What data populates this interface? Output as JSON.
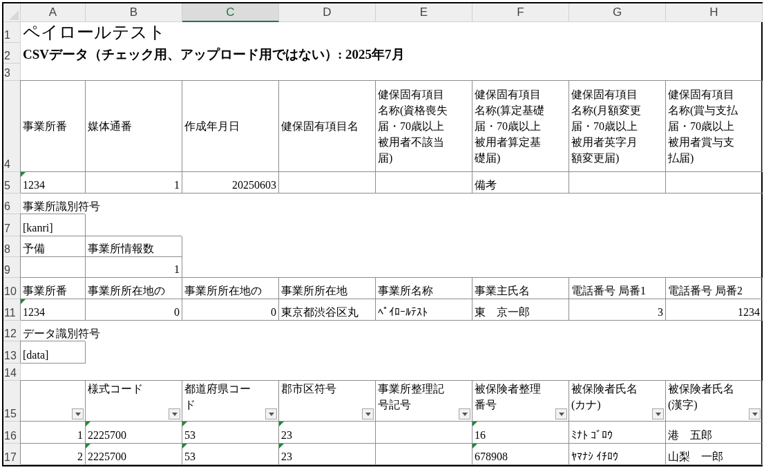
{
  "columns": [
    {
      "label": "A",
      "selected": false
    },
    {
      "label": "B",
      "selected": false
    },
    {
      "label": "C",
      "selected": true
    },
    {
      "label": "D",
      "selected": false
    },
    {
      "label": "E",
      "selected": false
    },
    {
      "label": "F",
      "selected": false
    },
    {
      "label": "G",
      "selected": false
    },
    {
      "label": "H",
      "selected": false
    }
  ],
  "rows": [
    {
      "label": "1",
      "cells": [
        {
          "text": "ペイロールテスト",
          "kind": "title",
          "bordered": false
        }
      ]
    },
    {
      "label": "2",
      "cells": [
        {
          "text": "CSVデータ（チェック用、アップロード用ではない）: 2025年7月",
          "kind": "subtitle",
          "bordered": false
        }
      ]
    },
    {
      "label": "3"
    },
    {
      "label": "4",
      "cells": [
        {
          "text": "事業所番",
          "kind": "text",
          "bordered": true
        },
        {
          "text": "媒体通番",
          "kind": "text",
          "bordered": true
        },
        {
          "text": "作成年月日",
          "kind": "text",
          "bordered": true
        },
        {
          "text": "健保固有項目名",
          "kind": "text",
          "bordered": true
        },
        {
          "text": "健保固有項目名称(資格喪失届・70歳以上被用者不該当届)",
          "kind": "text",
          "bordered": true
        },
        {
          "text": "健保固有項目名称(算定基礎届・70歳以上被用者算定基礎届)",
          "kind": "text",
          "bordered": true
        },
        {
          "text": "健保固有項目名称(月額変更届・70歳以上被用者英字月額変更届)",
          "kind": "text",
          "bordered": true
        },
        {
          "text": "健保固有項目名称(賞与支払届・70歳以上被用者賞与支払届)",
          "kind": "text",
          "bordered": true
        }
      ]
    },
    {
      "label": "5",
      "cells": [
        {
          "text": "1234",
          "kind": "number_text",
          "bordered": true
        },
        {
          "text": "1",
          "kind": "number",
          "bordered": true
        },
        {
          "text": "20250603",
          "kind": "number",
          "bordered": true
        },
        {
          "bordered": true
        },
        {
          "bordered": true
        },
        {
          "text": "備考",
          "kind": "text",
          "bordered": true
        },
        {
          "bordered": true
        },
        {
          "bordered": true
        }
      ]
    },
    {
      "label": "6",
      "cells": [
        {
          "text": "事業所識別符号",
          "kind": "text",
          "bordered": false
        }
      ]
    },
    {
      "label": "7",
      "cells": [
        {
          "text": "[kanri]",
          "kind": "text",
          "bordered": true
        }
      ]
    },
    {
      "label": "8",
      "cells": [
        {
          "text": "予備",
          "kind": "text",
          "bordered": true
        },
        {
          "text": "事業所情報数",
          "kind": "text",
          "bordered": true
        }
      ]
    },
    {
      "label": "9",
      "cells": [
        {
          "bordered": true
        },
        {
          "text": "1",
          "kind": "number",
          "bordered": true
        }
      ]
    },
    {
      "label": "10",
      "cells": [
        {
          "text": "事業所番",
          "kind": "text",
          "bordered": true
        },
        {
          "text": "事業所所在地の",
          "kind": "text",
          "bordered": true
        },
        {
          "text": "事業所所在地の",
          "kind": "text",
          "bordered": true
        },
        {
          "text": "事業所所在地",
          "kind": "text",
          "bordered": true
        },
        {
          "text": "事業所名称",
          "kind": "text",
          "bordered": true
        },
        {
          "text": "事業主氏名",
          "kind": "text",
          "bordered": true
        },
        {
          "text": "電話番号 局番1",
          "kind": "text",
          "bordered": true
        },
        {
          "text": "電話番号 局番2",
          "kind": "text",
          "bordered": true
        }
      ]
    },
    {
      "label": "11",
      "cells": [
        {
          "text": "1234",
          "kind": "number_text",
          "bordered": true
        },
        {
          "text": "0",
          "kind": "number",
          "bordered": true
        },
        {
          "text": "0",
          "kind": "number",
          "bordered": true
        },
        {
          "text": "東京都渋谷区丸",
          "kind": "text",
          "bordered": true
        },
        {
          "text": "ﾍﾟｲﾛｰﾙﾃｽﾄ",
          "kind": "text",
          "bordered": true
        },
        {
          "text": "東　京一郎",
          "kind": "text",
          "bordered": true
        },
        {
          "text": "3",
          "kind": "number",
          "bordered": true
        },
        {
          "text": "1234",
          "kind": "number",
          "bordered": true
        }
      ]
    },
    {
      "label": "12",
      "cells": [
        {
          "text": "データ識別符号",
          "kind": "text",
          "bordered": false
        }
      ]
    },
    {
      "label": "13",
      "cells": [
        {
          "text": "[data]",
          "kind": "text",
          "bordered": true
        }
      ]
    },
    {
      "label": "14"
    },
    {
      "label": "15",
      "cells": [
        {
          "bordered": true,
          "filter": true
        },
        {
          "text": "様式コード",
          "kind": "text",
          "bordered": true,
          "filter": true
        },
        {
          "text": "都道府県コード",
          "kind": "text",
          "bordered": true,
          "filter": true
        },
        {
          "text": "郡市区符号",
          "kind": "text",
          "bordered": true,
          "filter": true
        },
        {
          "text": "事業所整理記号記号",
          "kind": "text",
          "bordered": true,
          "filter": true
        },
        {
          "text": "被保険者整理番号",
          "kind": "text",
          "bordered": true,
          "filter": true
        },
        {
          "text": "被保険者氏名\n(カナ)",
          "kind": "text",
          "bordered": true,
          "filter": true
        },
        {
          "text": "被保険者氏名\n(漢字)",
          "kind": "text",
          "bordered": true,
          "filter": true
        }
      ]
    },
    {
      "label": "16",
      "cells": [
        {
          "text": "1",
          "kind": "number",
          "bordered": true
        },
        {
          "text": "2225700",
          "kind": "number_text",
          "bordered": true
        },
        {
          "text": "53",
          "kind": "number_text",
          "bordered": true
        },
        {
          "text": "23",
          "kind": "number_text",
          "bordered": true
        },
        {
          "bordered": true
        },
        {
          "text": "16",
          "kind": "number_text",
          "bordered": true
        },
        {
          "text": "ﾐﾅﾄ ｺﾞﾛｳ",
          "kind": "text",
          "bordered": true
        },
        {
          "text": "港　五郎",
          "kind": "text",
          "bordered": true
        }
      ]
    },
    {
      "label": "17",
      "cells": [
        {
          "text": "2",
          "kind": "number",
          "bordered": true
        },
        {
          "text": "2225700",
          "kind": "number_text",
          "bordered": true
        },
        {
          "text": "53",
          "kind": "number_text",
          "bordered": true
        },
        {
          "text": "23",
          "kind": "number_text",
          "bordered": true
        },
        {
          "bordered": true
        },
        {
          "text": "678908",
          "kind": "number_text",
          "bordered": true
        },
        {
          "text": "ﾔﾏﾅｼ ｲﾁﾛｳ",
          "kind": "text",
          "bordered": true
        },
        {
          "text": "山梨　一郎",
          "kind": "text",
          "bordered": true
        }
      ]
    }
  ]
}
